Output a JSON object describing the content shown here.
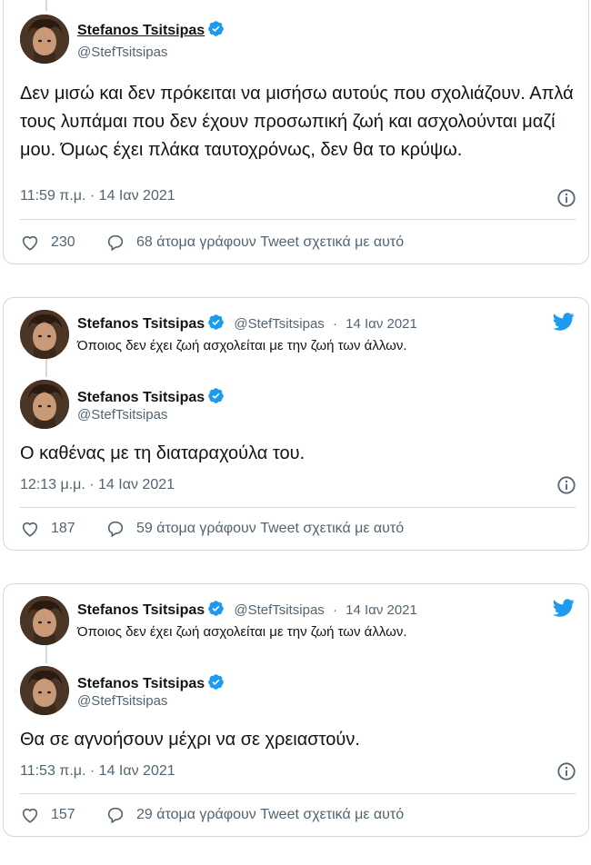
{
  "brand_color": "#1d9bf0",
  "tweets": [
    {
      "author": "Stefanos Tsitsipas",
      "handle": "@StefTsitsipas",
      "text": "Δεν μισώ και δεν πρόκειται να μισήσω αυτούς που σχολιάζουν. Απλά τους λυπάμαι που δεν έχουν προσωπική ζωή και ασχολούνται μαζί μου. Όμως έχει πλάκα ταυτοχρόνως, δεν θα το κρύψω.",
      "timestamp": "11:59 π.μ. · 14 Ιαν 2021",
      "likes": "230",
      "replies_label": "68 άτομα γράφουν Tweet σχετικά με αυτό"
    },
    {
      "parent": {
        "author": "Stefanos Tsitsipas",
        "handle": "@StefTsitsipas",
        "date": "14 Ιαν 2021",
        "text": "Όποιος δεν έχει ζωή ασχολείται με την ζωή των άλλων."
      },
      "author": "Stefanos Tsitsipas",
      "handle": "@StefTsitsipas",
      "text": "Ο καθένας με τη διαταραχούλα του.",
      "timestamp": "12:13 μ.μ. · 14 Ιαν 2021",
      "likes": "187",
      "replies_label": "59 άτομα γράφουν Tweet σχετικά με αυτό"
    },
    {
      "parent": {
        "author": "Stefanos Tsitsipas",
        "handle": "@StefTsitsipas",
        "date": "14 Ιαν 2021",
        "text": "Όποιος δεν έχει ζωή ασχολείται με την ζωή των άλλων."
      },
      "author": "Stefanos Tsitsipas",
      "handle": "@StefTsitsipas",
      "text": "Θα σε αγνοήσουν μέχρι να σε χρειαστούν.",
      "timestamp": "11:53 π.μ. · 14 Ιαν 2021",
      "likes": "157",
      "replies_label": "29 άτομα γράφουν Tweet σχετικά με αυτό"
    }
  ]
}
